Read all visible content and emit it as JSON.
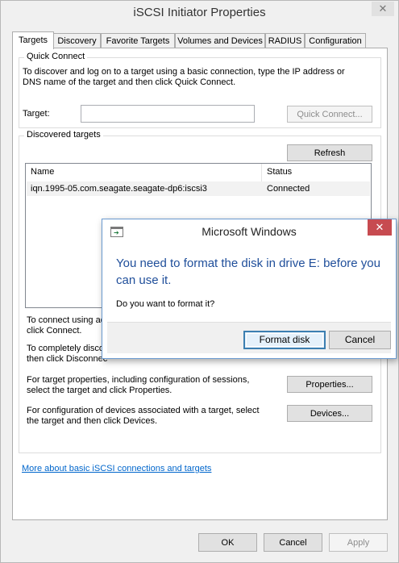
{
  "window": {
    "title": "iSCSI Initiator Properties",
    "close_glyph": "✕"
  },
  "tabs": [
    {
      "label": "Targets"
    },
    {
      "label": "Discovery"
    },
    {
      "label": "Favorite Targets"
    },
    {
      "label": "Volumes and Devices"
    },
    {
      "label": "RADIUS"
    },
    {
      "label": "Configuration"
    }
  ],
  "quick_connect": {
    "group_label": "Quick Connect",
    "description": "To discover and log on to a target using a basic connection, type the IP address or DNS name of the target and then click Quick Connect.",
    "target_label": "Target:",
    "target_value": "",
    "button": "Quick Connect..."
  },
  "discovered": {
    "group_label": "Discovered targets",
    "refresh_button": "Refresh",
    "columns": [
      "Name",
      "Status"
    ],
    "rows": [
      {
        "name": "iqn.1995-05.com.seagate.seagate-dp6:iscsi3",
        "status": "Connected"
      }
    ],
    "connect_text": "To connect using advanced options, select a target and then click Connect.",
    "connect_text_visible": "To connect using ad",
    "connect_text_line2": "click Connect.",
    "disconnect_text_visible": "To completely disco",
    "disconnect_text_line2": "then click Disconnec",
    "properties_text": "For target properties, including configuration of sessions, select the target and click Properties.",
    "properties_button": "Properties...",
    "devices_text": "For configuration of devices associated with a target, select the target and then click Devices.",
    "devices_button": "Devices..."
  },
  "link": {
    "text": "More about basic iSCSI connections and targets"
  },
  "footer": {
    "ok": "OK",
    "cancel": "Cancel",
    "apply": "Apply"
  },
  "dialog": {
    "title": "Microsoft Windows",
    "close_glyph": "✕",
    "heading": "You need to format the disk in drive E: before you can use it.",
    "body": "Do you want to format it?",
    "format_button": "Format disk",
    "cancel_button": "Cancel",
    "icon_glyph": "➔"
  }
}
